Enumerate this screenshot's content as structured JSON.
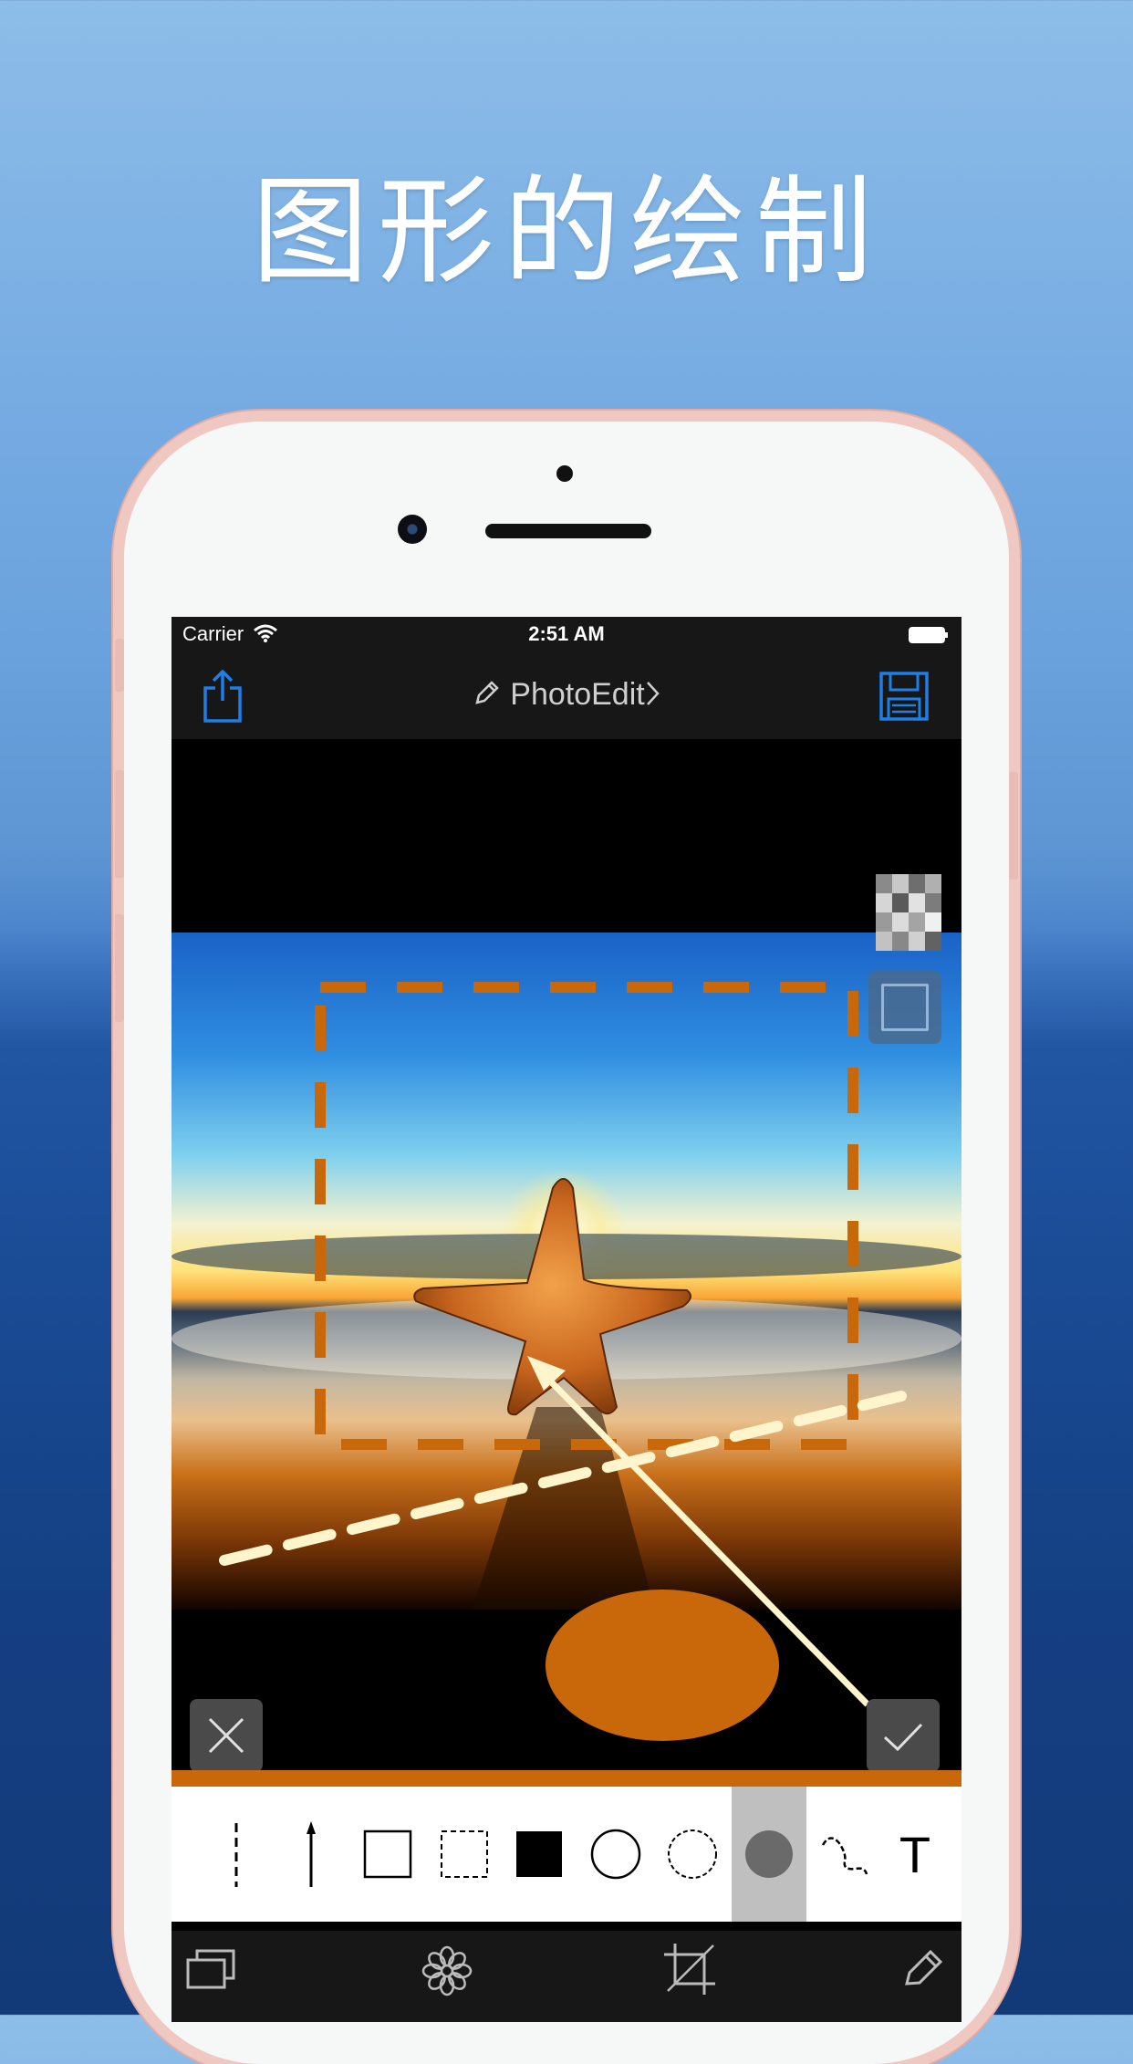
{
  "headline": "图形的绘制",
  "status_bar": {
    "carrier": "Carrier",
    "time": "2:51 AM"
  },
  "nav": {
    "title": "PhotoEdit",
    "left_icon": "share-icon",
    "right_icon": "save-icon",
    "title_icon": "pencil-icon"
  },
  "drawing_tools": [
    {
      "name": "dashed-line-tool",
      "selected": false
    },
    {
      "name": "arrow-tool",
      "selected": false
    },
    {
      "name": "rectangle-tool",
      "selected": false
    },
    {
      "name": "dashed-rectangle-tool",
      "selected": false
    },
    {
      "name": "filled-rectangle-tool",
      "selected": false
    },
    {
      "name": "circle-tool",
      "selected": false
    },
    {
      "name": "dashed-circle-tool",
      "selected": false
    },
    {
      "name": "filled-circle-tool",
      "selected": true
    },
    {
      "name": "freehand-tool",
      "selected": false
    },
    {
      "name": "text-tool",
      "selected": false
    }
  ],
  "text_tool_label": "T",
  "bottom_tabs": [
    "layers-icon",
    "filter-icon",
    "crop-icon",
    "pencil-icon"
  ],
  "colors": {
    "accent": "#c8680a",
    "shape_cream": "#fff5cc",
    "shape_orange": "#c8680a",
    "icon_blue": "#1e7fe6",
    "selected_tool_bg": "#bfbfbf"
  }
}
